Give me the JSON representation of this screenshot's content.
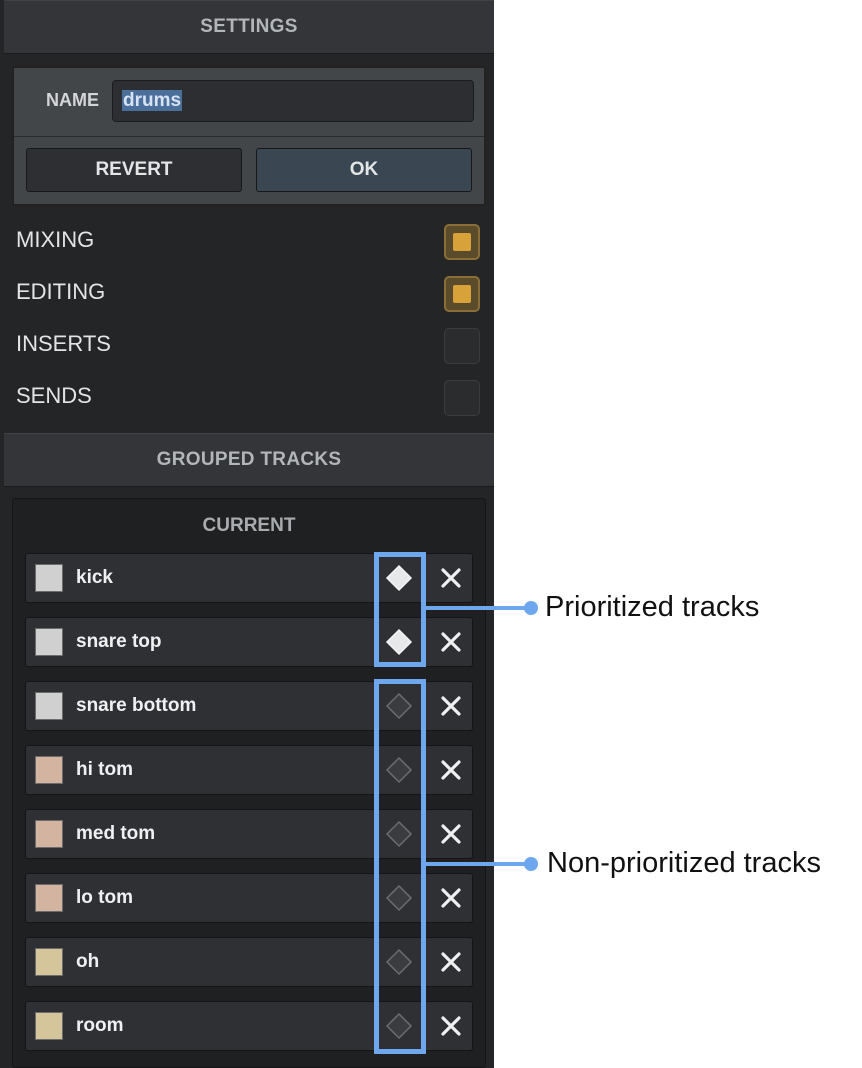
{
  "settings": {
    "header": "SETTINGS",
    "name_label": "NAME",
    "name_value": "drums",
    "revert_label": "REVERT",
    "ok_label": "OK",
    "options": [
      {
        "label": "MIXING",
        "checked": true
      },
      {
        "label": "EDITING",
        "checked": true
      },
      {
        "label": "INSERTS",
        "checked": false
      },
      {
        "label": "SENDS",
        "checked": false
      }
    ]
  },
  "grouped": {
    "header": "GROUPED TRACKS",
    "current_title": "CURRENT",
    "tracks": [
      {
        "name": "kick",
        "color": "#d0d0d0",
        "prioritized": true
      },
      {
        "name": "snare top",
        "color": "#d0d0d0",
        "prioritized": true
      },
      {
        "name": "snare bottom",
        "color": "#d0d0d0",
        "prioritized": false
      },
      {
        "name": "hi tom",
        "color": "#d3b4a0",
        "prioritized": false
      },
      {
        "name": "med tom",
        "color": "#d3b4a0",
        "prioritized": false
      },
      {
        "name": "lo tom",
        "color": "#d3b4a0",
        "prioritized": false
      },
      {
        "name": "oh",
        "color": "#d4c69a",
        "prioritized": false
      },
      {
        "name": "room",
        "color": "#d4c69a",
        "prioritized": false
      }
    ]
  },
  "annotations": {
    "prioritized": "Prioritized tracks",
    "non_prioritized": "Non-prioritized tracks",
    "highlight_color": "#6fa7ee"
  },
  "icons": {
    "prioritize": "diamond-icon",
    "remove": "close-icon"
  },
  "colors": {
    "panel_bg": "#242527",
    "accent_checkbox": "#d8a23a",
    "ok_button": "#3a4753"
  }
}
